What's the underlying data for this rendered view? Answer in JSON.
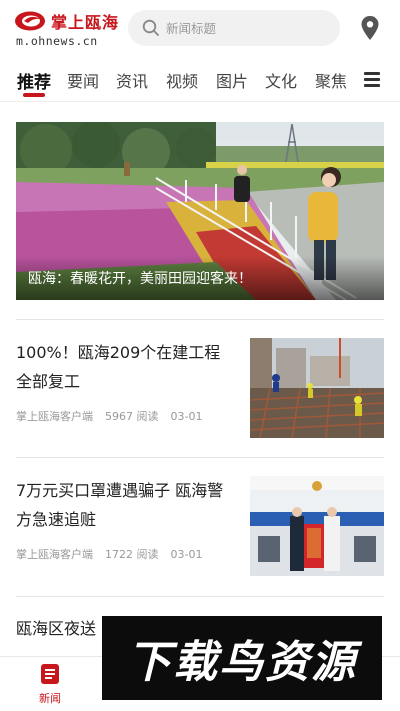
{
  "header": {
    "logo_name": "掌上瓯海",
    "logo_url": "m.ohnews.cn",
    "search_placeholder": "新闻标题"
  },
  "tabs": [
    {
      "label": "推荐",
      "active": true
    },
    {
      "label": "要闻",
      "active": false
    },
    {
      "label": "资讯",
      "active": false
    },
    {
      "label": "视频",
      "active": false
    },
    {
      "label": "图片",
      "active": false
    },
    {
      "label": "文化",
      "active": false
    },
    {
      "label": "聚焦",
      "active": false
    }
  ],
  "hero": {
    "caption": "瓯海：春暖花开，美丽田园迎客来！"
  },
  "news": [
    {
      "title": "100%！瓯海209个在建工程全部复工",
      "source": "掌上瓯海客户端",
      "reads": "5967 阅读",
      "date": "03-01"
    },
    {
      "title": "7万元买口罩遭遇骗子 瓯海警方急速追赃",
      "source": "掌上瓯海客户端",
      "reads": "1722 阅读",
      "date": "03-01"
    },
    {
      "title": "瓯海区夜送",
      "source": "",
      "reads": "",
      "date": ""
    }
  ],
  "bottom_nav": [
    {
      "label": "新闻",
      "active": true,
      "icon": "news-icon"
    }
  ],
  "watermark": {
    "text": "下载鸟资源"
  },
  "colors": {
    "brand": "#c8161d",
    "text": "#222222",
    "meta": "#999999"
  }
}
